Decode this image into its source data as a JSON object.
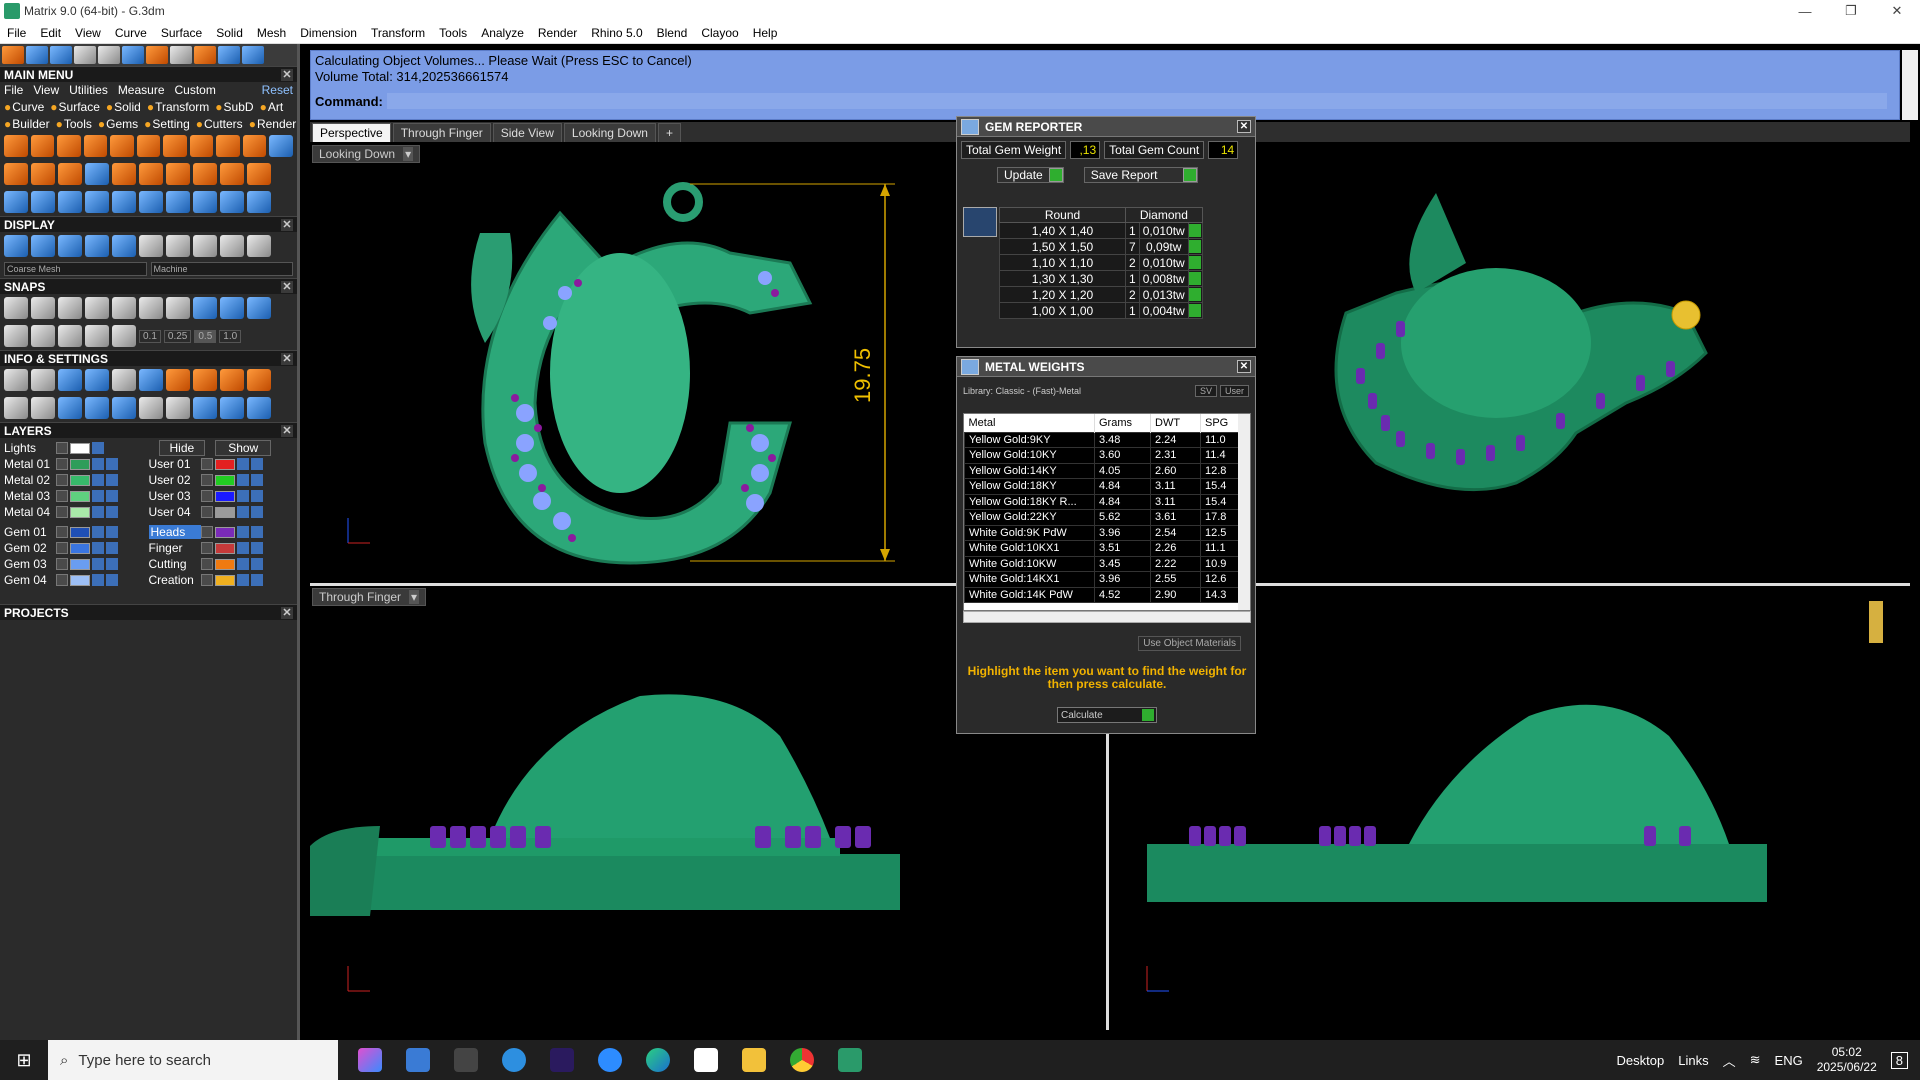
{
  "window": {
    "title": "Matrix 9.0 (64-bit) - G.3dm",
    "controls": [
      "—",
      "❐",
      "✕"
    ]
  },
  "menubar": [
    "File",
    "Edit",
    "View",
    "Curve",
    "Surface",
    "Solid",
    "Mesh",
    "Dimension",
    "Transform",
    "Tools",
    "Analyze",
    "Render",
    "Rhino 5.0",
    "Blend",
    "Clayoo",
    "Help"
  ],
  "left": {
    "main_menu": "MAIN MENU",
    "submenu": [
      "File",
      "View",
      "Utilities",
      "Measure",
      "Custom"
    ],
    "reset": "Reset",
    "cats1": [
      "Curve",
      "Surface",
      "Solid",
      "Transform",
      "SubD",
      "Art"
    ],
    "cats2": [
      "Builder",
      "Tools",
      "Gems",
      "Setting",
      "Cutters",
      "Render"
    ],
    "display": "DISPLAY",
    "mesh_mode": "Coarse Mesh",
    "render_mode": "Machine",
    "snaps": "SNAPS",
    "snap_vals": [
      "0.1",
      "0.25",
      "0.5",
      "1.0"
    ],
    "info": "INFO & SETTINGS",
    "layers": "LAYERS",
    "lights": "Lights",
    "hide": "Hide",
    "show": "Show",
    "layers_left": [
      {
        "name": "Metal 01",
        "color": "#2e9d5a"
      },
      {
        "name": "Metal 02",
        "color": "#37b86a"
      },
      {
        "name": "Metal 03",
        "color": "#5fd07f"
      },
      {
        "name": "Metal 04",
        "color": "#a9e8a9"
      },
      {
        "name": "Gem 01",
        "color": "#1f4fb5"
      },
      {
        "name": "Gem 02",
        "color": "#3a75e0"
      },
      {
        "name": "Gem 03",
        "color": "#6a9df0"
      },
      {
        "name": "Gem 04",
        "color": "#9dbff5"
      }
    ],
    "layers_right": [
      {
        "name": "User 01",
        "color": "#e32020"
      },
      {
        "name": "User 02",
        "color": "#22cc22"
      },
      {
        "name": "User 03",
        "color": "#1a1aff"
      },
      {
        "name": "User 04",
        "color": "#9a9a9a"
      },
      {
        "name": "Heads",
        "color": "#7a2bb8"
      },
      {
        "name": "Finger",
        "color": "#c53a3a"
      },
      {
        "name": "Cutting",
        "color": "#f07a10"
      },
      {
        "name": "Creation",
        "color": "#f0b020"
      }
    ],
    "projects": "PROJECTS"
  },
  "command": {
    "line1": "Calculating Object Volumes... Please Wait (Press ESC to Cancel)",
    "line2": "Volume Total: 314,202536661574",
    "label": "Command:"
  },
  "tabs": [
    "Perspective",
    "Through Finger",
    "Side View",
    "Looking Down",
    "+"
  ],
  "viewports": {
    "top_left": "Looking Down",
    "bottom_left": "Through Finger",
    "dimension": "19.75"
  },
  "gem_reporter": {
    "title": "GEM REPORTER",
    "total_weight_label": "Total Gem Weight",
    "total_weight": ",13",
    "total_count_label": "Total Gem Count",
    "total_count": "14",
    "update": "Update",
    "save": "Save Report",
    "col_shape": "Round",
    "col_type": "Diamond",
    "rows": [
      {
        "size": "1,40 X 1,40",
        "qty": "1",
        "wt": "0,010tw"
      },
      {
        "size": "1,50 X 1,50",
        "qty": "7",
        "wt": "0,09tw"
      },
      {
        "size": "1,10 X 1,10",
        "qty": "2",
        "wt": "0,010tw"
      },
      {
        "size": "1,30 X 1,30",
        "qty": "1",
        "wt": "0,008tw"
      },
      {
        "size": "1,20 X 1,20",
        "qty": "2",
        "wt": "0,013tw"
      },
      {
        "size": "1,00 X 1,00",
        "qty": "1",
        "wt": "0,004tw"
      }
    ]
  },
  "metal_weights": {
    "title": "METAL WEIGHTS",
    "library": "Library: Classic - (Fast)-Metal",
    "btn_sv": "SV",
    "btn_user": "User",
    "headers": [
      "Metal",
      "Grams",
      "DWT",
      "SPG"
    ],
    "rows": [
      [
        "Yellow Gold:9KY",
        "3.48",
        "2.24",
        "11.0"
      ],
      [
        "Yellow Gold:10KY",
        "3.60",
        "2.31",
        "11.4"
      ],
      [
        "Yellow Gold:14KY",
        "4.05",
        "2.60",
        "12.8"
      ],
      [
        "Yellow Gold:18KY",
        "4.84",
        "3.11",
        "15.4"
      ],
      [
        "Yellow Gold:18KY R...",
        "4.84",
        "3.11",
        "15.4"
      ],
      [
        "Yellow Gold:22KY",
        "5.62",
        "3.61",
        "17.8"
      ],
      [
        "White Gold:9K PdW",
        "3.96",
        "2.54",
        "12.5"
      ],
      [
        "White Gold:10KX1",
        "3.51",
        "2.26",
        "11.1"
      ],
      [
        "White Gold:10KW",
        "3.45",
        "2.22",
        "10.9"
      ],
      [
        "White Gold:14KX1",
        "3.96",
        "2.55",
        "12.6"
      ],
      [
        "White Gold:14K PdW",
        "4.52",
        "2.90",
        "14.3"
      ]
    ],
    "use_object": "Use Object Materials",
    "hint": "Highlight the item you want to find the weight for then press calculate.",
    "calculate": "Calculate"
  },
  "taskbar": {
    "search": "Type here to search",
    "desktop": "Desktop",
    "links": "Links",
    "lang": "ENG",
    "time": "05:02",
    "date": "2025/06/22",
    "notif": "8"
  }
}
